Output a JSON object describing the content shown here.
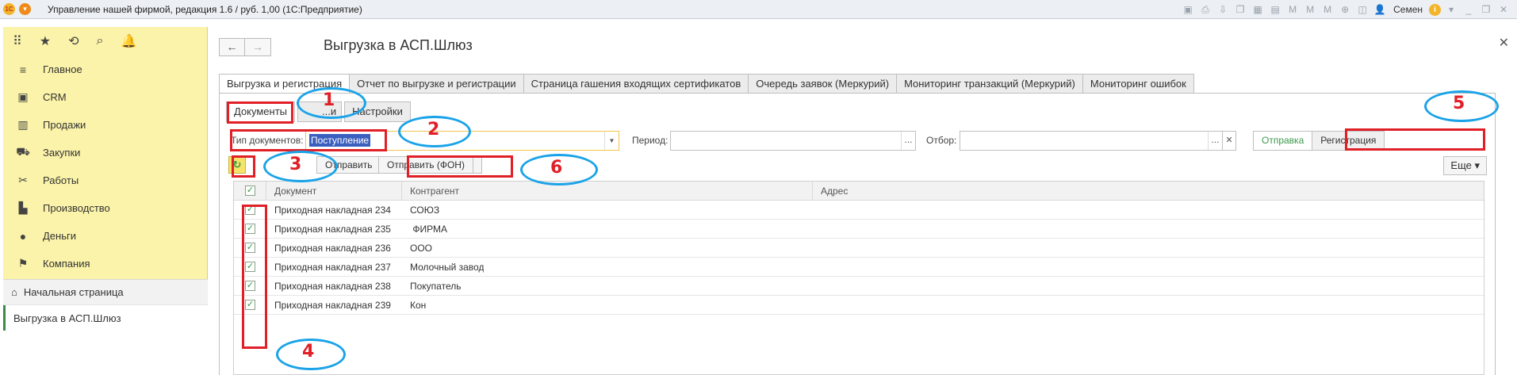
{
  "titlebar": {
    "title": "Управление нашей фирмой, редакция 1.6 / руб. 1,00  (1С:Предприятие)",
    "logo": "1С",
    "user": "Семен"
  },
  "sidebar": {
    "items": [
      {
        "label": "Главное",
        "icon": "menu-lines-icon"
      },
      {
        "label": "CRM",
        "icon": "contacts-icon"
      },
      {
        "label": "Продажи",
        "icon": "cash-register-icon"
      },
      {
        "label": "Закупки",
        "icon": "cart-icon"
      },
      {
        "label": "Работы",
        "icon": "tools-icon"
      },
      {
        "label": "Производство",
        "icon": "factory-icon"
      },
      {
        "label": "Деньги",
        "icon": "coin-icon"
      },
      {
        "label": "Компания",
        "icon": "flag-icon"
      }
    ],
    "home": "Начальная страница",
    "current": "Выгрузка в АСП.Шлюз"
  },
  "page": {
    "title": "Выгрузка в АСП.Шлюз",
    "tabs": [
      "Выгрузка и регистрация",
      "Отчет по выгрузке и регистрации",
      "Страница гашения входящих сертификатов",
      "Очередь заявок (Меркурий)",
      "Мониторинг транзакций (Меркурий)",
      "Мониторинг ошибок"
    ],
    "subtabs": [
      "Документы",
      "...и",
      "Настройки"
    ]
  },
  "filters": {
    "doc_type_label": "Тип документов:",
    "doc_type_value": "Поступление",
    "period_label": "Период:",
    "filter_label": "Отбор:",
    "mode_send": "Отправка",
    "mode_register": "Регистрация"
  },
  "toolbar": {
    "send": "Отправить",
    "send_bg": "Отправить (ФОН)",
    "more": "Еще"
  },
  "table": {
    "columns": [
      "Документ",
      "Контрагент",
      "Адрес"
    ],
    "rows": [
      {
        "doc": "Приходная накладная 234 ...",
        "agent": "СОЮЗ",
        "checked": true
      },
      {
        "doc": "Приходная накладная 235 ...",
        "agent": " ФИРМА",
        "checked": true
      },
      {
        "doc": "Приходная накладная 236 ...",
        "agent": "ООО",
        "checked": true
      },
      {
        "doc": "Приходная накладная 237 ...",
        "agent": "Молочный завод",
        "checked": true
      },
      {
        "doc": "Приходная накладная 238 ...",
        "agent": "Покупатель",
        "checked": true
      },
      {
        "doc": "Приходная накладная 239 ...",
        "agent": "Кон",
        "checked": true
      }
    ]
  },
  "annotations": [
    "1",
    "2",
    "3",
    "4",
    "5",
    "6"
  ],
  "colors": {
    "sidebar": "#fbf3a9",
    "annotation_red": "#e01f26",
    "annotation_blue": "#1aa3e8",
    "accent_green": "#3a9a4a"
  }
}
